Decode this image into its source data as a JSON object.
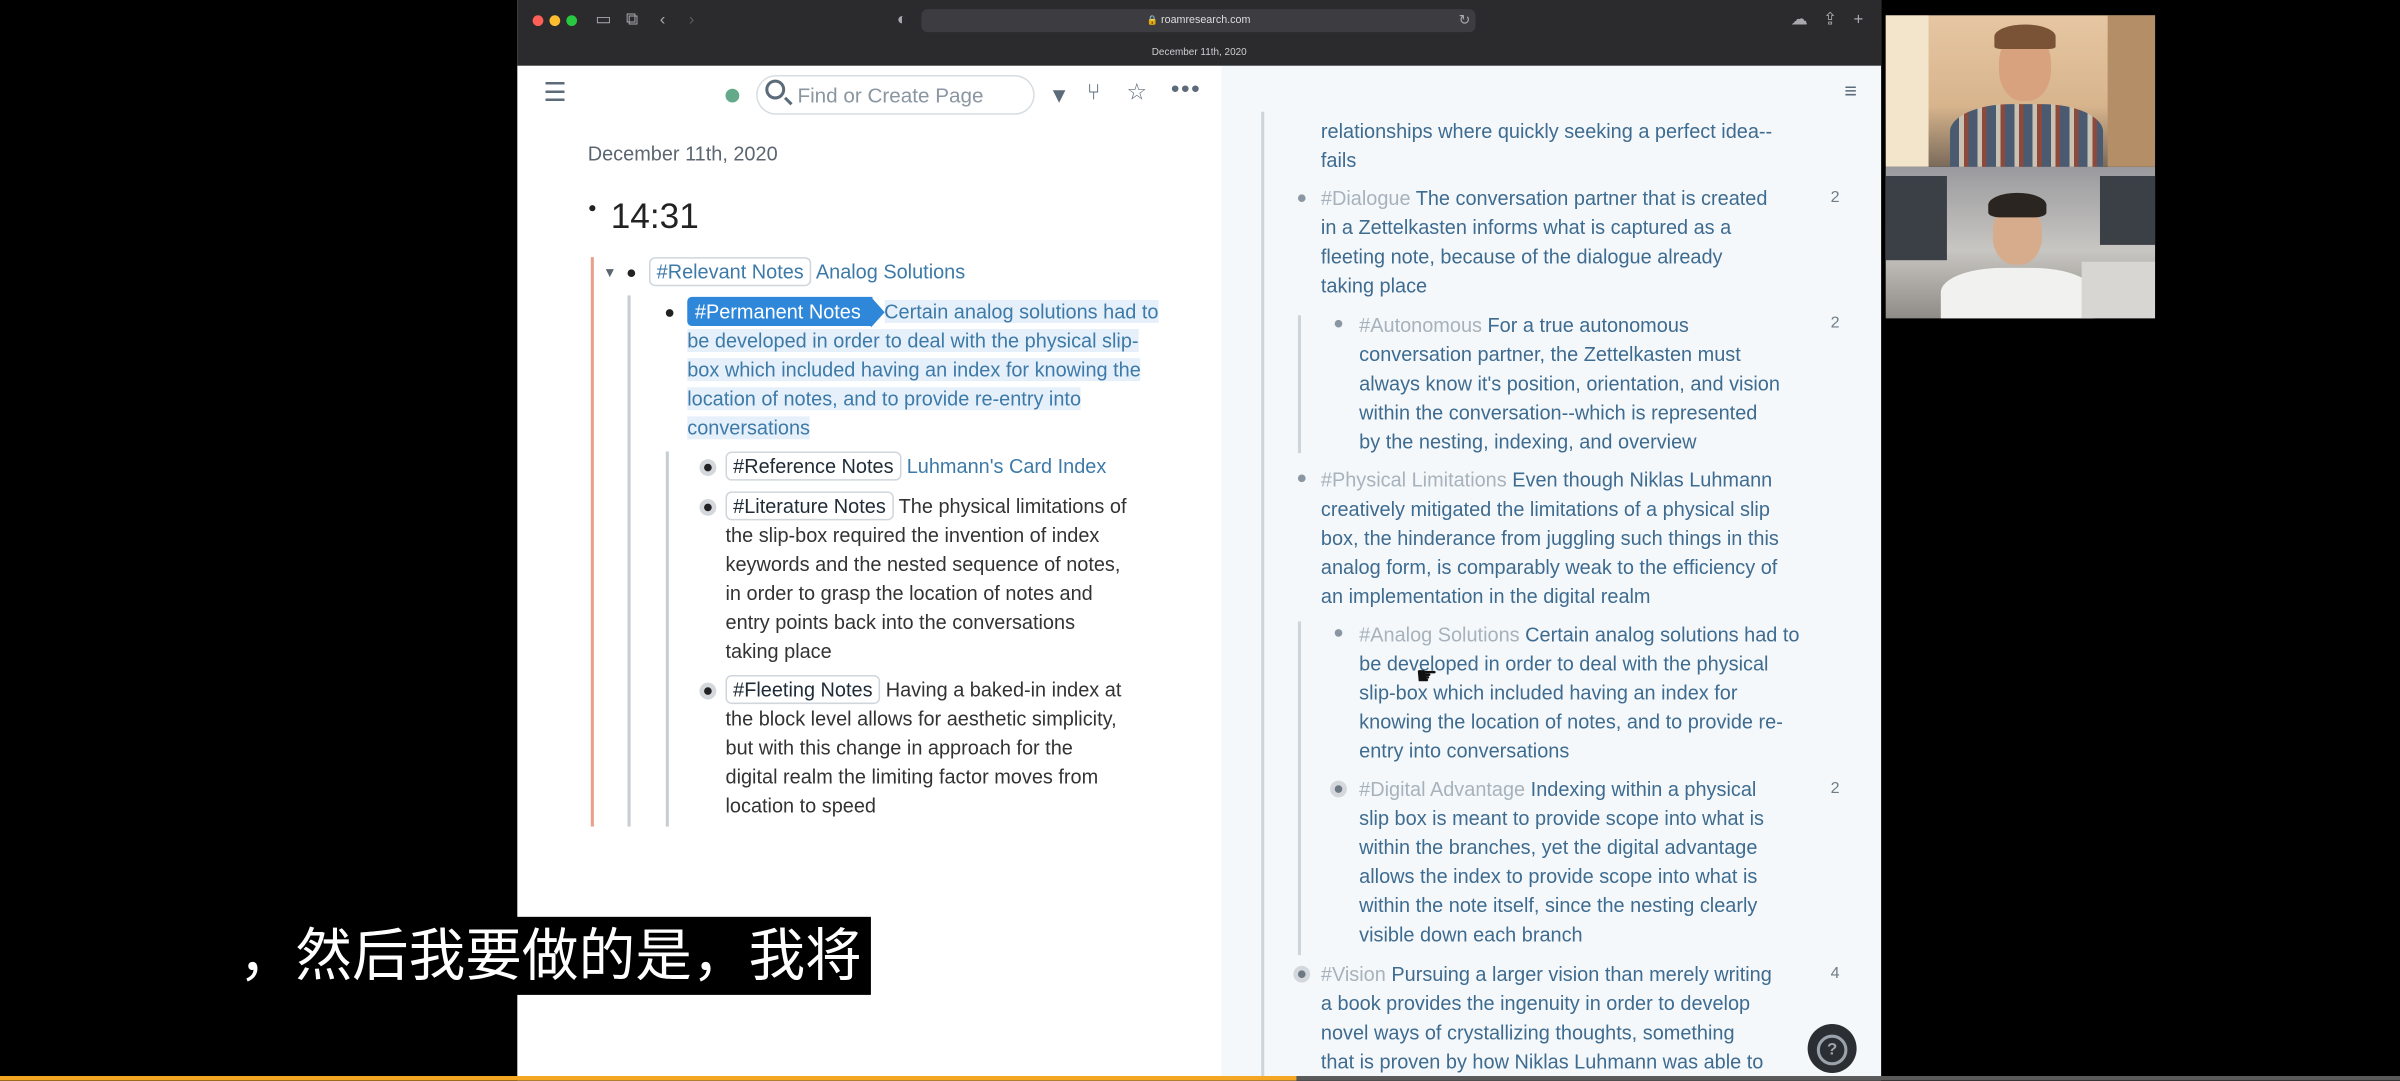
{
  "browser": {
    "url": "roamresearch.com",
    "tab_title": "December 11th, 2020"
  },
  "topbar": {
    "search_placeholder": "Find or Create Page",
    "menu_icon": "hamburger-menu-icon",
    "filter_icon": "filter-icon",
    "graph_icon": "graph-icon",
    "star_icon": "star-icon",
    "more_icon": "more-options-icon",
    "sidebar_toggle_icon": "right-sidebar-icon"
  },
  "page": {
    "date_title": "December 11th, 2020",
    "time_block": "14:31",
    "block1": {
      "tag": "#Relevant Notes",
      "text": "Analog Solutions"
    },
    "block2": {
      "tag": "#Permanent Notes",
      "lines": [
        "Certain analog solutions had to",
        "be developed in order to deal with the physical slip-",
        "box which included having an index for knowing the",
        "location of notes, and to provide re-entry into",
        "conversations"
      ]
    },
    "children": [
      {
        "tag": "#Reference Notes",
        "lines": [
          "Luhmann's Card Index"
        ]
      },
      {
        "tag": "#Literature Notes",
        "lines": [
          "The physical limitations of",
          "the slip-box required the invention of index",
          "keywords and the nested sequence of notes,",
          "in order to grasp the location of notes and",
          "entry points back into the conversations",
          "taking place"
        ]
      },
      {
        "tag": "#Fleeting Notes",
        "lines": [
          "Having a baked-in index at",
          "the block level allows for aesthetic simplicity,",
          "but with this change in approach for the",
          "digital realm the limiting factor moves from",
          "location to speed"
        ]
      }
    ]
  },
  "sidebar": {
    "blocks": [
      {
        "tag": "",
        "lines": [
          "relationships where quickly seeking a perfect idea--",
          "fails"
        ],
        "count": ""
      },
      {
        "tag": "#Dialogue",
        "lines": [
          "The conversation partner that is created",
          "in a Zettelkasten informs what is captured as a",
          "fleeting note, because of the dialogue already",
          "taking place"
        ],
        "count": "2"
      },
      {
        "tag": "#Autonomous",
        "lines": [
          "For a true autonomous",
          "conversation partner, the Zettelkasten must",
          "always know it's position, orientation, and vision",
          "within the conversation--which is represented",
          "by the nesting, indexing, and overview"
        ],
        "count": "2"
      },
      {
        "tag": "#Physical Limitations",
        "lines": [
          "Even though Niklas Luhmann",
          "creatively mitigated the limitations of a physical slip",
          "box, the hinderance from juggling such things in this",
          "analog form, is comparably weak to the efficiency of",
          "an implementation in the digital realm"
        ],
        "count": ""
      },
      {
        "tag": "#Analog Solutions",
        "lines": [
          "Certain analog solutions had to",
          "be developed in order to deal with the physical",
          "slip-box which included having an index for",
          "knowing the location of notes, and to provide re-",
          "entry into conversations"
        ],
        "count": ""
      },
      {
        "tag": "#Digital Advantage",
        "lines": [
          "Indexing within a physical",
          "slip box is meant to provide scope into what is",
          "within the branches, yet the digital advantage",
          "allows the index to provide scope into what is",
          "within the note itself, since the nesting clearly",
          "visible down each branch"
        ],
        "count": "2"
      },
      {
        "tag": "#Vision",
        "lines": [
          "Pursuing a larger vision than merely writing",
          "a book provides the ingenuity in order to develop",
          "novel ways of crystallizing thoughts, something",
          "that is proven by how Niklas Luhmann was able to"
        ],
        "count": "4"
      }
    ],
    "help_label": "?"
  },
  "subtitle": "，然后我要做的是，我将",
  "video_progress": 0.54,
  "colors": {
    "accent": "#2f87d9",
    "link": "#3d7aa8",
    "progress": "#f5a623"
  }
}
